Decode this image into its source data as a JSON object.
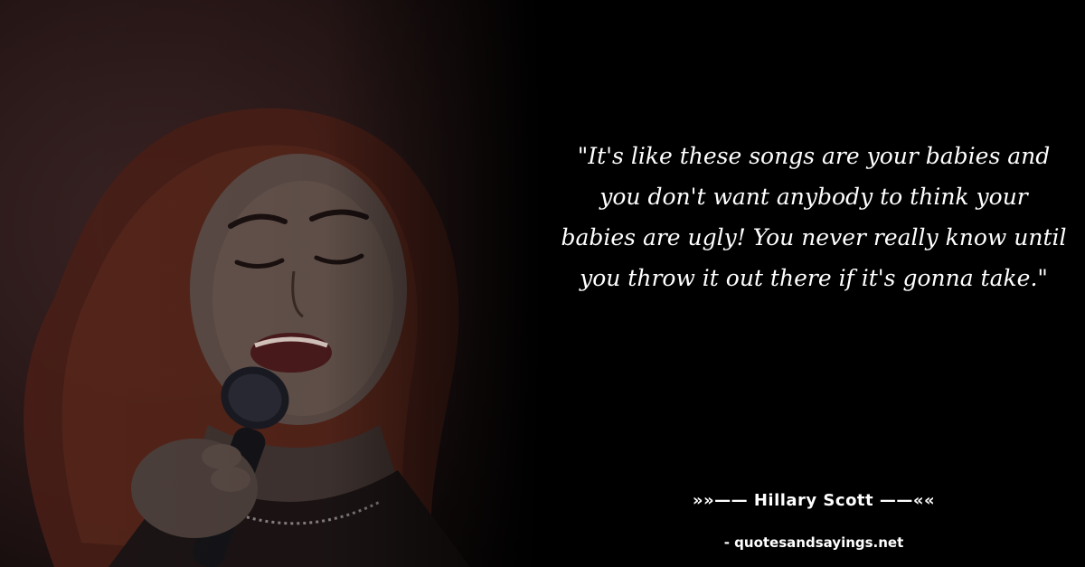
{
  "quote": {
    "text": "\"It's like these songs are your babies and you don't want anybody to think your babies are ugly! You never really know until you throw it out there if it's gonna take.\""
  },
  "author": {
    "line": "»»—— Hillary Scott ——««"
  },
  "source": {
    "line": "- quotesandsayings.net"
  },
  "photo": {
    "subject_icon": "singer-with-microphone-photo"
  },
  "colors": {
    "background": "#000000",
    "text": "#ffffff",
    "hair": "#5a2a1e",
    "photo_tint": "#2a1818"
  }
}
